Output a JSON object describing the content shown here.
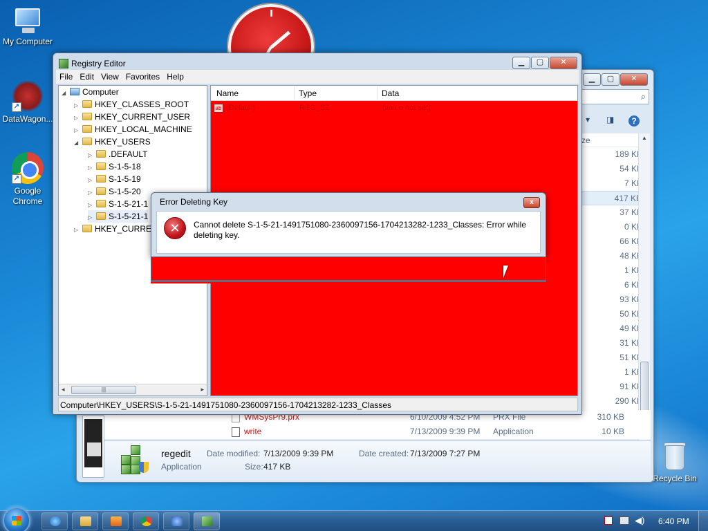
{
  "desktop": {
    "icons": [
      {
        "label": "My Computer",
        "icon": "computer-icon"
      },
      {
        "label": "DataWagon...",
        "icon": "datawagon-icon"
      },
      {
        "label": "Google Chrome",
        "icon": "chrome-icon"
      },
      {
        "label": "Recycle Bin",
        "icon": "recycle-bin-icon"
      }
    ]
  },
  "regedit": {
    "title": "Registry Editor",
    "menu": [
      "File",
      "Edit",
      "View",
      "Favorites",
      "Help"
    ],
    "tree": [
      {
        "label": "Computer",
        "icon": "computer-icon",
        "toggle": "expanded"
      },
      {
        "label": "HKEY_CLASSES_ROOT",
        "toggle": "collapsed"
      },
      {
        "label": "HKEY_CURRENT_USER",
        "toggle": "collapsed"
      },
      {
        "label": "HKEY_LOCAL_MACHINE",
        "toggle": "collapsed"
      },
      {
        "label": "HKEY_USERS",
        "toggle": "expanded"
      },
      {
        "label": ".DEFAULT",
        "toggle": "collapsed"
      },
      {
        "label": "S-1-5-18",
        "toggle": "collapsed"
      },
      {
        "label": "S-1-5-19",
        "toggle": "collapsed"
      },
      {
        "label": "S-1-5-20",
        "toggle": "collapsed"
      },
      {
        "label": "S-1-5-21-1",
        "toggle": "collapsed"
      },
      {
        "label": "S-1-5-21-1",
        "toggle": "collapsed"
      },
      {
        "label": "HKEY_CURREN",
        "toggle": "collapsed"
      }
    ],
    "columns": {
      "name": "Name",
      "type": "Type",
      "data": "Data"
    },
    "values": [
      {
        "name": "(Default)",
        "type": "REG_SZ",
        "data": "(value not set)"
      }
    ],
    "status": "Computer\\HKEY_USERS\\S-1-5-21-1491751080-2360097156-1704213282-1233_Classes",
    "colors": {
      "values_background": "#ff0000"
    }
  },
  "dialog": {
    "title": "Error Deleting Key",
    "message": "Cannot delete S-1-5-21-1491751080-2360097156-1704213282-1233_Classes:  Error while deleting key.",
    "close": "x"
  },
  "explorer": {
    "size_header": "ze",
    "sizes": [
      "189 KB",
      "54 KB",
      "7 KB",
      "417 KB",
      "37 KB",
      "0 KB",
      "66 KB",
      "48 KB",
      "1 KB",
      "6 KB",
      "93 KB",
      "50 KB",
      "49 KB",
      "31 KB",
      "51 KB",
      "1 KB",
      "91 KB",
      "290 KB"
    ],
    "selected_size_index": 3,
    "files": [
      {
        "name": "WMSysPr9.prx",
        "date": "6/10/2009 4:52 PM",
        "type": "PRX File",
        "size": "310 KB"
      },
      {
        "name": "write",
        "date": "7/13/2009 9:39 PM",
        "type": "Application",
        "size": "10 KB"
      }
    ],
    "details": {
      "name": "regedit",
      "type": "Application",
      "modified_label": "Date modified:",
      "modified": "7/13/2009 9:39 PM",
      "created_label": "Date created:",
      "created": "7/13/2009 7:27 PM",
      "size_label": "Size:",
      "size": "417 KB"
    }
  },
  "taskbar": {
    "time": "6:40 PM",
    "buttons": [
      "ie-icon",
      "folder-icon",
      "media-player-icon",
      "chrome-icon",
      "datawagon-icon",
      "regedit-icon"
    ]
  }
}
